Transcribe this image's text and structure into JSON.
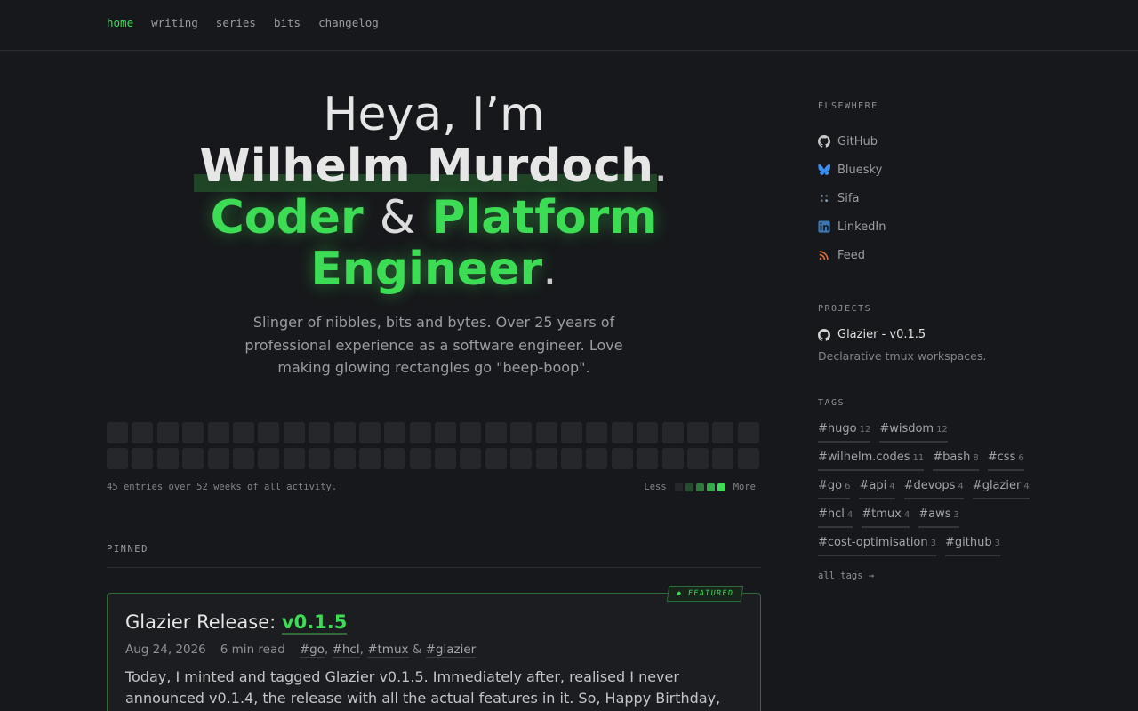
{
  "nav": {
    "items": [
      {
        "label": "home",
        "active": true
      },
      {
        "label": "writing",
        "active": false
      },
      {
        "label": "series",
        "active": false
      },
      {
        "label": "bits",
        "active": false
      },
      {
        "label": "changelog",
        "active": false
      }
    ]
  },
  "hero": {
    "greeting": "Heya, I’m",
    "name": "Wilhelm Murdoch",
    "role_word1": "Coder",
    "amp": "&",
    "role_word2": "Platform",
    "role_word3": "Engineer",
    "period": ".",
    "subtitle": "Slinger of nibbles, bits and bytes. Over 25 years of professional experience as a software engineer. Love making glowing rectangles go \"beep-boop\"."
  },
  "activity": {
    "summary": "45 entries over 52 weeks of all activity.",
    "legend_less": "Less",
    "legend_more": "More",
    "legend_colors": [
      "#25272b",
      "#254c2c",
      "#2d7a3b",
      "#36a94a",
      "#3ddc55"
    ],
    "cells": 52
  },
  "pinned": {
    "heading": "PINNED",
    "badge": "◆ FEATURED",
    "title_prefix": "Glazier Release:",
    "title_version": "v0.1.5",
    "date": "Aug 24, 2026",
    "read_time": "6 min read",
    "tags": [
      "#go",
      "#hcl",
      "#tmux",
      "#glazier"
    ],
    "sep_comma": ",",
    "sep_amp": "&",
    "body": "Today, I minted and tagged Glazier v0.1.5. Immediately after, realised I never announced v0.1.4, the release with all the actual features in it. So, Happy Birthday, you get a twofer."
  },
  "sidebar": {
    "elsewhere_heading": "ELSEWHERE",
    "links": [
      {
        "label": "GitHub",
        "icon": "github-icon",
        "color": "#c9c9c9"
      },
      {
        "label": "Bluesky",
        "icon": "bluesky-icon",
        "color": "#3b8ef0"
      },
      {
        "label": "Sifa",
        "icon": "sifa-icon",
        "color": "#8aa0b4"
      },
      {
        "label": "LinkedIn",
        "icon": "linkedin-icon",
        "color": "#3a78b5"
      },
      {
        "label": "Feed",
        "icon": "rss-icon",
        "color": "#d9733a"
      }
    ],
    "projects_heading": "PROJECTS",
    "project_name": "Glazier - v0.1.5",
    "project_desc": "Declarative tmux workspaces.",
    "tags_heading": "TAGS",
    "tags": [
      {
        "name": "#hugo",
        "count": "12"
      },
      {
        "name": "#wisdom",
        "count": "12"
      },
      {
        "name": "#wilhelm.codes",
        "count": "11"
      },
      {
        "name": "#bash",
        "count": "8"
      },
      {
        "name": "#css",
        "count": "6"
      },
      {
        "name": "#go",
        "count": "6"
      },
      {
        "name": "#api",
        "count": "4"
      },
      {
        "name": "#devops",
        "count": "4"
      },
      {
        "name": "#glazier",
        "count": "4"
      },
      {
        "name": "#hcl",
        "count": "4"
      },
      {
        "name": "#tmux",
        "count": "4"
      },
      {
        "name": "#aws",
        "count": "3"
      },
      {
        "name": "#cost-optimisation",
        "count": "3"
      },
      {
        "name": "#github",
        "count": "3"
      }
    ],
    "all_tags": "all tags →"
  }
}
